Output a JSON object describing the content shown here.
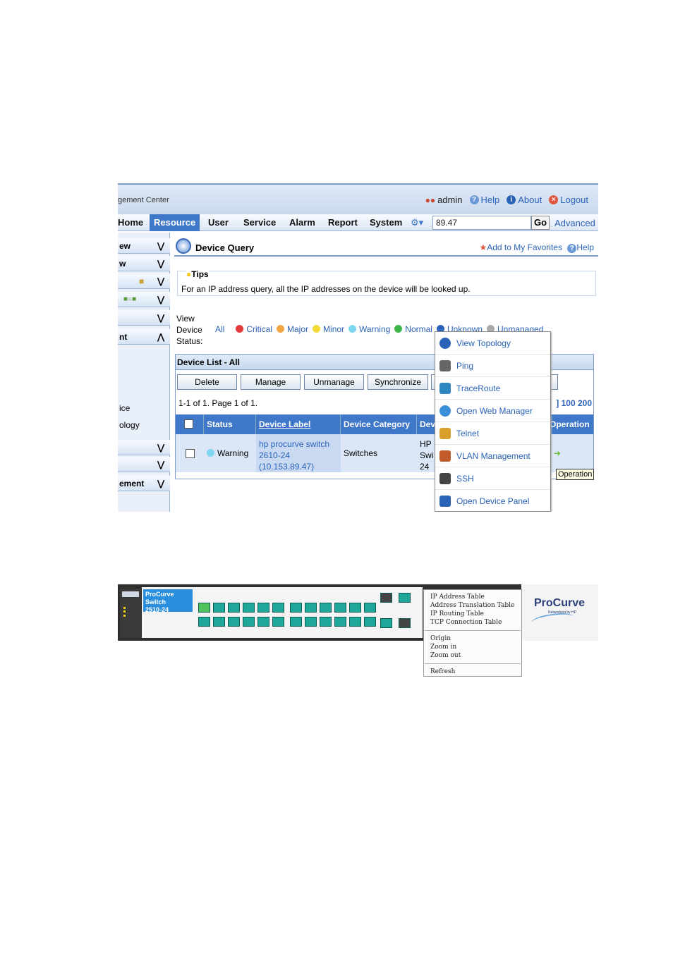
{
  "header": {
    "app_title": "gement Center",
    "user": "admin",
    "help": "Help",
    "about": "About",
    "logout": "Logout"
  },
  "nav": {
    "items": [
      "Home",
      "Resource",
      "User",
      "Service",
      "Alarm",
      "Report",
      "System"
    ],
    "search_value": "89.47",
    "go": "Go",
    "advanced": "Advanced"
  },
  "sidebar": {
    "rows": [
      "ew",
      "w",
      "",
      "",
      "",
      "nt"
    ],
    "plain": [
      "ice",
      "ology"
    ],
    "rows2": [
      "",
      "",
      "ement"
    ]
  },
  "page": {
    "title": "Device Query",
    "add_fav": "Add to My Favorites",
    "help": "Help",
    "tips_label": "Tips",
    "tips_text": "For an IP address query, all the IP addresses on the device will be looked up.",
    "view_label": "View\nDevice\nStatus:",
    "status_filters": [
      {
        "label": "All",
        "color": ""
      },
      {
        "label": "Critical",
        "color": "#e23b3b"
      },
      {
        "label": "Major",
        "color": "#f2a443"
      },
      {
        "label": "Minor",
        "color": "#f3da3b"
      },
      {
        "label": "Warning",
        "color": "#7fd6f0"
      },
      {
        "label": "Normal",
        "color": "#3bb54a"
      },
      {
        "label": "Unknown",
        "color": "#2a62b8"
      },
      {
        "label": "Unmanaged",
        "color": "#aaaaaa"
      }
    ]
  },
  "device_list": {
    "title": "Device List - All",
    "buttons": [
      "Delete",
      "Manage",
      "Unmanage",
      "Synchronize"
    ],
    "pager": "1-1 of 1. Page 1 of 1.",
    "per_page": "] 100 200",
    "columns": [
      "Status",
      "Device Label",
      "Device Category",
      "Dev",
      "Operation"
    ],
    "row": {
      "status": "Warning",
      "label_line1": "hp procurve switch",
      "label_line2": "2610-24",
      "label_line3": "(10.153.89.47)",
      "category": "Switches",
      "dev_line1": "HP",
      "dev_line2": "Swi",
      "dev_line3": "24"
    }
  },
  "context_menu": {
    "items": [
      {
        "label": "View Topology",
        "icon": "topology-icon",
        "color": "#2a62b8"
      },
      {
        "label": "Ping",
        "icon": "ping-icon",
        "color": "#666"
      },
      {
        "label": "TraceRoute",
        "icon": "traceroute-icon",
        "color": "#2e86c1"
      },
      {
        "label": "Open Web Manager",
        "icon": "web-manager-icon",
        "color": "#3b8fd9"
      },
      {
        "label": "Telnet",
        "icon": "telnet-icon",
        "color": "#d8a12b"
      },
      {
        "label": "VLAN Management",
        "icon": "vlan-icon",
        "color": "#c25a2a"
      },
      {
        "label": "SSH",
        "icon": "ssh-icon",
        "color": "#444"
      },
      {
        "label": "Open Device Panel",
        "icon": "device-panel-icon",
        "color": "#2a62b8"
      }
    ],
    "tooltip": "Operation"
  },
  "device_panel": {
    "model_tag_line1": "ProCurve Switch",
    "model_tag_line2": "2510-24",
    "brand": "ProCurve",
    "brand_sub": "Networking by HP",
    "menu_group1": [
      "IP Address Table",
      "Address Translation Table",
      "IP Routing Table",
      "TCP Connection Table"
    ],
    "menu_group2": [
      "Origin",
      "Zoom in",
      "Zoom out"
    ],
    "menu_group3": [
      "Refresh"
    ]
  }
}
